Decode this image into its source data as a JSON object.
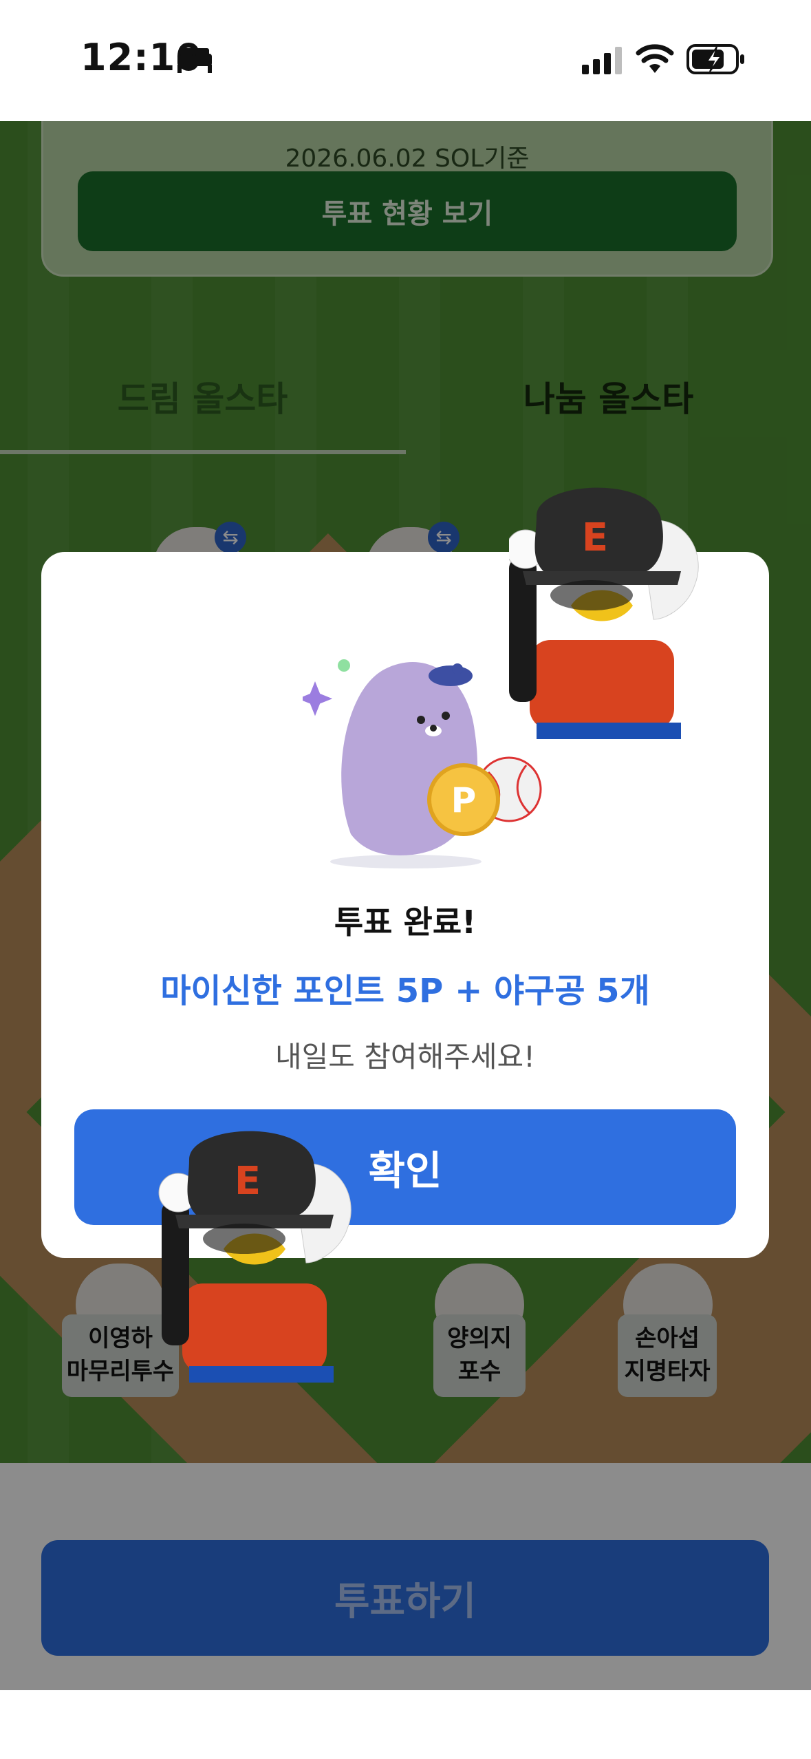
{
  "status_bar": {
    "time": "12:10"
  },
  "summary": {
    "date_text": "2026.06.02 SOL기준",
    "status_button": "투표 현황 보기"
  },
  "tabs": [
    {
      "label": "드림 올스타"
    },
    {
      "label": "나눔 올스타"
    }
  ],
  "players": [
    {
      "name": "이영하",
      "position": "마무리투수"
    },
    {
      "name": "양의지",
      "position": "포수"
    },
    {
      "name": "손아섭",
      "position": "지명타자"
    }
  ],
  "vote_button": "투표하기",
  "modal": {
    "title": "투표 완료!",
    "reward": "마이신한 포인트 5P + 야구공 5개",
    "note": "내일도 참여해주세요!",
    "confirm": "확인"
  },
  "colors": {
    "primary": "#2f6fe0",
    "field_green": "#4f8f33",
    "status_green": "#1a6f2a"
  },
  "icons": [
    "bed-icon",
    "signal-icon",
    "wifi-icon",
    "battery-charging-icon",
    "swap-icon",
    "point-coin-icon",
    "baseball-icon"
  ]
}
